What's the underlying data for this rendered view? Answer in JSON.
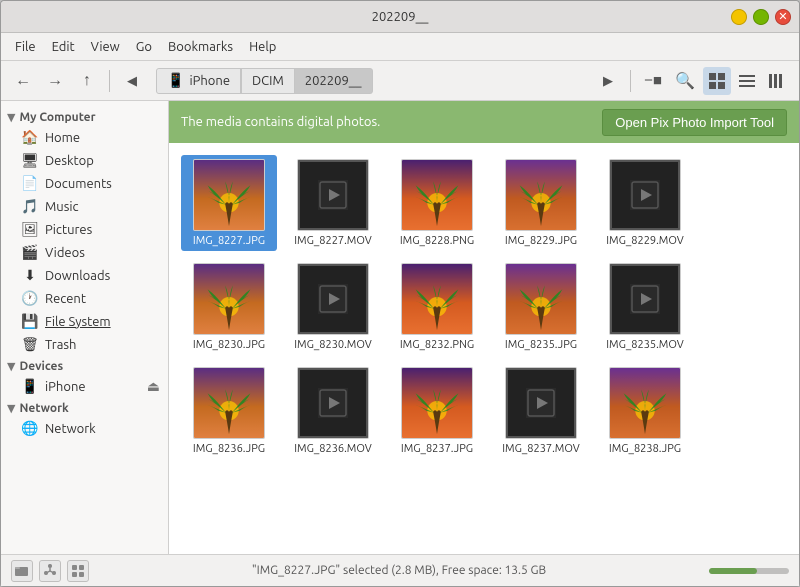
{
  "window": {
    "title": "202209__",
    "controls": {
      "minimize": "−",
      "maximize": "□",
      "close": "✕"
    }
  },
  "menubar": {
    "items": [
      "File",
      "Edit",
      "View",
      "Go",
      "Bookmarks",
      "Help"
    ]
  },
  "toolbar": {
    "back_tooltip": "Back",
    "forward_tooltip": "Forward",
    "up_tooltip": "Up",
    "breadcrumbs": [
      "iPhone",
      "DCIM",
      "202209__"
    ],
    "view_grid_label": "⊞",
    "view_list_label": "☰",
    "view_compact_label": "⋮"
  },
  "infobar": {
    "message": "The media contains digital photos.",
    "button_label": "Open Pix Photo Import Tool"
  },
  "sidebar": {
    "my_computer_label": "My Computer",
    "items_computer": [
      {
        "label": "Home",
        "icon": "🏠"
      },
      {
        "label": "Desktop",
        "icon": "🖥"
      },
      {
        "label": "Documents",
        "icon": "📄"
      },
      {
        "label": "Music",
        "icon": "🎵"
      },
      {
        "label": "Pictures",
        "icon": "🖼"
      },
      {
        "label": "Videos",
        "icon": "🎬"
      },
      {
        "label": "Downloads",
        "icon": "⬇"
      },
      {
        "label": "Recent",
        "icon": "🕐"
      },
      {
        "label": "File System",
        "icon": "💾"
      },
      {
        "label": "Trash",
        "icon": "🗑"
      }
    ],
    "devices_label": "Devices",
    "items_devices": [
      {
        "label": "iPhone",
        "icon": "📱",
        "eject": true
      }
    ],
    "network_label": "Network",
    "items_network": [
      {
        "label": "Network",
        "icon": "🌐"
      }
    ]
  },
  "files": [
    {
      "name": "IMG_8227.JPG",
      "type": "photo",
      "selected": true
    },
    {
      "name": "IMG_8227.MOV",
      "type": "video"
    },
    {
      "name": "IMG_8228.PNG",
      "type": "photo"
    },
    {
      "name": "IMG_8229.JPG",
      "type": "photo"
    },
    {
      "name": "IMG_8229.MOV",
      "type": "video"
    },
    {
      "name": "IMG_8230.JPG",
      "type": "photo"
    },
    {
      "name": "IMG_8230.MOV",
      "type": "video"
    },
    {
      "name": "IMG_8232.PNG",
      "type": "photo"
    },
    {
      "name": "IMG_8235.JPG",
      "type": "photo"
    },
    {
      "name": "IMG_8235.MOV",
      "type": "video"
    },
    {
      "name": "IMG_8236.JPG",
      "type": "photo"
    },
    {
      "name": "IMG_8236.MOV",
      "type": "video"
    },
    {
      "name": "IMG_8237.JPG",
      "type": "photo"
    },
    {
      "name": "IMG_8237.MOV",
      "type": "video"
    },
    {
      "name": "IMG_8238.JPG",
      "type": "photo"
    }
  ],
  "statusbar": {
    "text": "\"IMG_8227.JPG\" selected (2.8 MB), Free space: 13.5 GB",
    "zoom_percent": 60
  }
}
